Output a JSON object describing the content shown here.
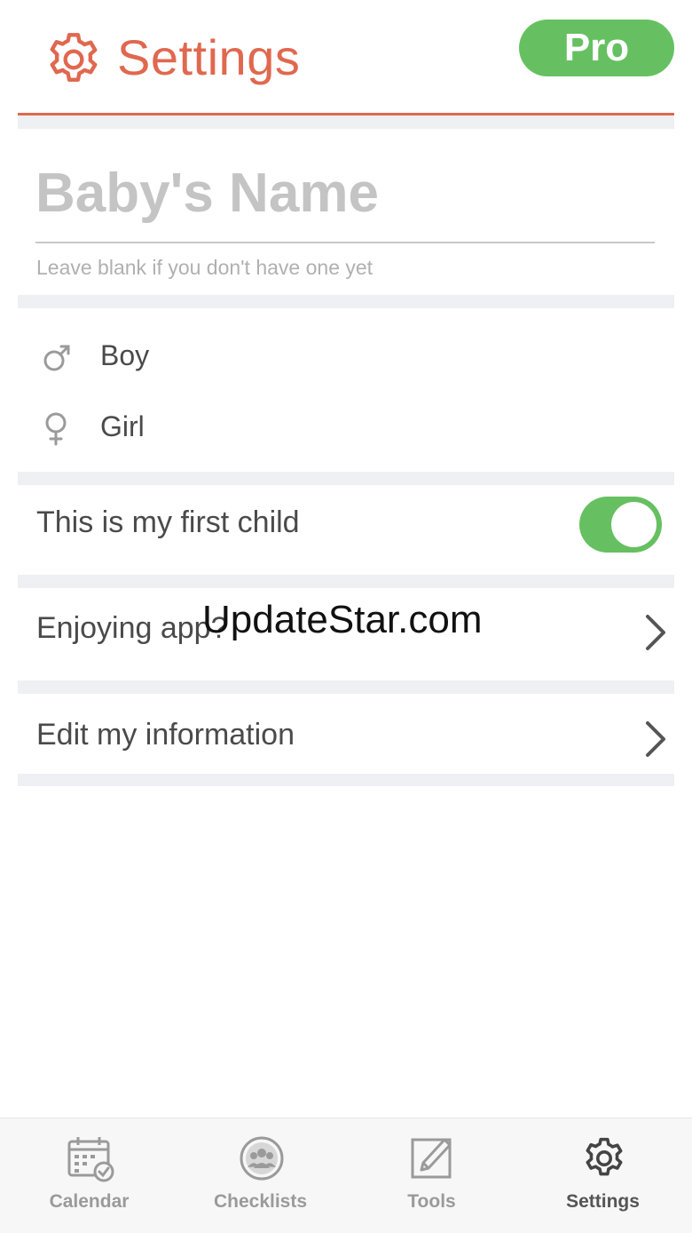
{
  "header": {
    "title": "Settings",
    "pro_label": "Pro",
    "gear_icon": "gear-icon"
  },
  "name_field": {
    "placeholder": "Baby's Name",
    "value": "",
    "help": "Leave blank if you don't have one yet"
  },
  "gender": {
    "options": [
      {
        "label": "Boy",
        "icon": "male-icon"
      },
      {
        "label": "Girl",
        "icon": "female-icon"
      }
    ]
  },
  "first_child": {
    "label": "This is my first child",
    "enabled": true
  },
  "menu": {
    "enjoying_app": "Enjoying app?",
    "edit_info": "Edit my information"
  },
  "watermark": "UpdateStar.com",
  "tabbar": {
    "tabs": [
      {
        "label": "Calendar",
        "icon": "calendar-icon",
        "active": false
      },
      {
        "label": "Checklists",
        "icon": "checklists-icon",
        "active": false
      },
      {
        "label": "Tools",
        "icon": "tools-icon",
        "active": false
      },
      {
        "label": "Settings",
        "icon": "gear-icon",
        "active": true
      }
    ]
  },
  "colors": {
    "accent": "#e0684f",
    "pro_green": "#66c061",
    "section_gap": "#eef0f3"
  }
}
